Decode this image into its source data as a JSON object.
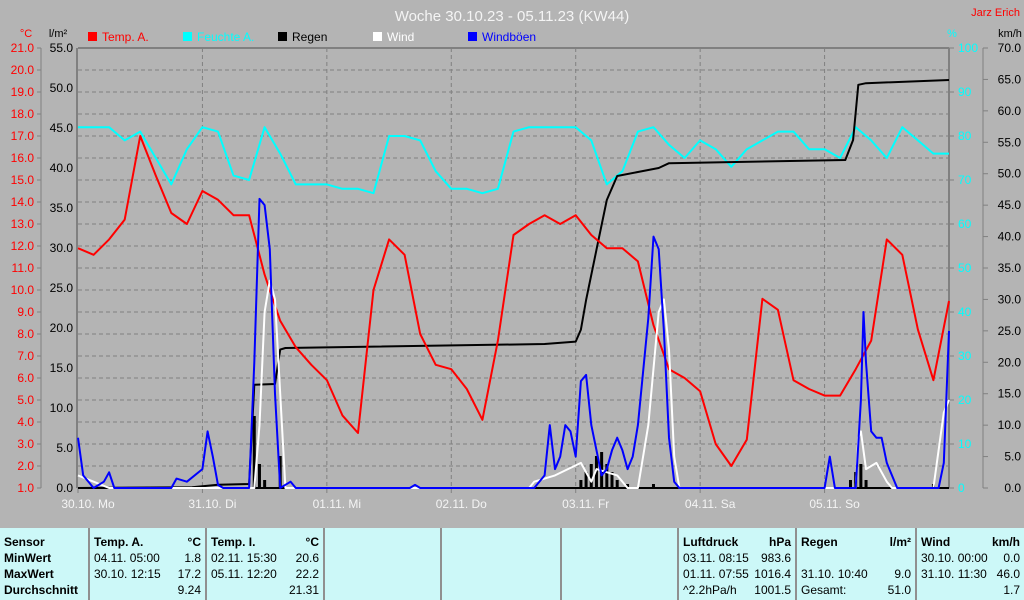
{
  "title": "Woche 30.10.23 - 05.11.23 (KW44)",
  "author": "Jarz Erich",
  "chart_data": {
    "type": "line",
    "title": "Woche 30.10.23 - 05.11.23 (KW44)",
    "x_unit": "hours since 30.10. 00:00",
    "xlim": [
      0,
      168
    ],
    "x_tick_labels": [
      "30.10. Mo",
      "31.10. Di",
      "01.11. Mi",
      "02.11. Do",
      "03.11. Fr",
      "04.11. Sa",
      "05.11. So"
    ],
    "axes": {
      "temp": {
        "label": "°C",
        "ylim": [
          1,
          21
        ],
        "ticks": [
          "1.0",
          "2.0",
          "3.0",
          "4.0",
          "5.0",
          "6.0",
          "7.0",
          "8.0",
          "9.0",
          "10.0",
          "11.0",
          "12.0",
          "13.0",
          "14.0",
          "15.0",
          "16.0",
          "17.0",
          "18.0",
          "19.0",
          "20.0",
          "21.0"
        ]
      },
      "rain": {
        "label": "l/m²",
        "ylim": [
          0,
          55
        ],
        "ticks": [
          "0.0",
          "5.0",
          "10.0",
          "15.0",
          "20.0",
          "25.0",
          "30.0",
          "35.0",
          "40.0",
          "45.0",
          "50.0",
          "55.0"
        ]
      },
      "humidity": {
        "label": "%",
        "ylim": [
          0,
          100
        ],
        "ticks": [
          "0",
          "10",
          "20",
          "30",
          "40",
          "50",
          "60",
          "70",
          "80",
          "90",
          "100"
        ]
      },
      "wind": {
        "label": "km/h",
        "ylim": [
          0,
          70
        ],
        "ticks": [
          "0.0",
          "5.0",
          "10.0",
          "15.0",
          "20.0",
          "25.0",
          "30.0",
          "35.0",
          "40.0",
          "45.0",
          "50.0",
          "55.0",
          "60.0",
          "65.0",
          "70.0"
        ]
      }
    },
    "legend_position": "top-left",
    "grid": true,
    "series": [
      {
        "name": "Temp. A.",
        "axis": "temp",
        "color": "#ff0000",
        "step_hours": 3,
        "values": [
          11.9,
          11.6,
          12.3,
          13.2,
          17.0,
          15.2,
          13.5,
          13.0,
          14.5,
          14.1,
          13.4,
          13.4,
          10.7,
          8.6,
          7.4,
          6.6,
          5.9,
          4.3,
          3.5,
          10.0,
          12.3,
          11.6,
          8.0,
          6.6,
          6.4,
          5.5,
          4.1,
          7.7,
          12.5,
          13.0,
          13.4,
          13.0,
          13.4,
          12.5,
          11.9,
          11.9,
          11.3,
          8.4,
          6.4,
          6.0,
          5.4,
          3.0,
          2.0,
          3.2,
          9.6,
          9.1,
          5.9,
          5.5,
          5.2,
          5.2,
          6.4,
          7.7,
          12.3,
          11.6,
          8.2,
          5.9,
          9.5
        ]
      },
      {
        "name": "Feuchte A.",
        "axis": "humidity",
        "color": "#00ffff",
        "step_hours": 3,
        "values": [
          82,
          82,
          82,
          79,
          81,
          75,
          69,
          77,
          82,
          81,
          71,
          70,
          82,
          76,
          69,
          69,
          69,
          68,
          68,
          67,
          80,
          80,
          79,
          72,
          68,
          68,
          67,
          68,
          81,
          82,
          82,
          82,
          82,
          79,
          69,
          72,
          81,
          82,
          78,
          75,
          79,
          77,
          73,
          77,
          79,
          81,
          81,
          77,
          77,
          75,
          82,
          79,
          75,
          82,
          79,
          76,
          76
        ]
      },
      {
        "name": "Regen",
        "axis": "rain",
        "color": "#000000",
        "points": [
          [
            0,
            0
          ],
          [
            22,
            0.1
          ],
          [
            27,
            0.4
          ],
          [
            33,
            0.5
          ],
          [
            34,
            12.9
          ],
          [
            38,
            13
          ],
          [
            39,
            17.3
          ],
          [
            40,
            17.5
          ],
          [
            90,
            18
          ],
          [
            96,
            18.3
          ],
          [
            97,
            19.8
          ],
          [
            98,
            23.5
          ],
          [
            100,
            29.8
          ],
          [
            102,
            36
          ],
          [
            104,
            39
          ],
          [
            108,
            39.5
          ],
          [
            112,
            40
          ],
          [
            114,
            40.6
          ],
          [
            148,
            41
          ],
          [
            149.5,
            43.5
          ],
          [
            150.5,
            50.4
          ],
          [
            152,
            50.6
          ],
          [
            168,
            51
          ]
        ],
        "bars": [
          [
            34,
            9
          ],
          [
            35,
            3
          ],
          [
            36,
            1
          ],
          [
            39,
            4
          ],
          [
            97,
            1
          ],
          [
            98,
            2
          ],
          [
            99,
            3
          ],
          [
            100,
            4
          ],
          [
            101,
            4.5
          ],
          [
            102,
            3
          ],
          [
            103,
            2
          ],
          [
            104,
            1
          ],
          [
            106,
            0.5
          ],
          [
            111,
            0.5
          ],
          [
            149,
            1
          ],
          [
            150,
            2
          ],
          [
            151,
            3
          ],
          [
            152,
            1
          ],
          [
            165,
            0.5
          ]
        ]
      },
      {
        "name": "Wind",
        "axis": "wind",
        "color": "#ffffff",
        "points": [
          [
            0,
            2
          ],
          [
            3,
            1
          ],
          [
            6,
            0
          ],
          [
            34,
            0
          ],
          [
            35,
            10
          ],
          [
            36,
            28
          ],
          [
            37,
            33
          ],
          [
            38,
            30
          ],
          [
            39,
            15
          ],
          [
            40,
            0
          ],
          [
            87,
            0
          ],
          [
            88,
            1
          ],
          [
            92,
            2
          ],
          [
            97,
            4
          ],
          [
            99,
            1
          ],
          [
            100,
            3
          ],
          [
            104,
            2
          ],
          [
            106,
            0
          ],
          [
            108,
            0
          ],
          [
            110,
            10
          ],
          [
            112,
            28
          ],
          [
            113,
            30
          ],
          [
            114,
            22
          ],
          [
            115,
            5
          ],
          [
            116,
            0
          ],
          [
            150,
            0
          ],
          [
            150.5,
            8
          ],
          [
            151,
            9
          ],
          [
            152,
            3
          ],
          [
            154,
            4
          ],
          [
            156,
            1
          ],
          [
            157,
            0
          ],
          [
            165,
            0
          ],
          [
            166,
            6
          ],
          [
            167,
            12
          ],
          [
            168,
            14
          ]
        ]
      },
      {
        "name": "Windböen",
        "axis": "wind",
        "color": "#0000ff",
        "points": [
          [
            0,
            8
          ],
          [
            1,
            2
          ],
          [
            3,
            0
          ],
          [
            5,
            1
          ],
          [
            6,
            2.5
          ],
          [
            7,
            0
          ],
          [
            18,
            0
          ],
          [
            19,
            1.5
          ],
          [
            21,
            1
          ],
          [
            24,
            3
          ],
          [
            25,
            9
          ],
          [
            26,
            5
          ],
          [
            27,
            0.5
          ],
          [
            28,
            0
          ],
          [
            33,
            0
          ],
          [
            34,
            20
          ],
          [
            35,
            46
          ],
          [
            36,
            45
          ],
          [
            37,
            38
          ],
          [
            38,
            15
          ],
          [
            39,
            0
          ],
          [
            41,
            1
          ],
          [
            42,
            0
          ],
          [
            64,
            0
          ],
          [
            65,
            0.5
          ],
          [
            66,
            0
          ],
          [
            88,
            0
          ],
          [
            90,
            2
          ],
          [
            91,
            10
          ],
          [
            92,
            3
          ],
          [
            93,
            5
          ],
          [
            94,
            10
          ],
          [
            95,
            9
          ],
          [
            96,
            5
          ],
          [
            97,
            17
          ],
          [
            98,
            18
          ],
          [
            99,
            10
          ],
          [
            100,
            6
          ],
          [
            101,
            2
          ],
          [
            102,
            3
          ],
          [
            103,
            6
          ],
          [
            104,
            8
          ],
          [
            105,
            6
          ],
          [
            106,
            3
          ],
          [
            107,
            5
          ],
          [
            108,
            10
          ],
          [
            110,
            27
          ],
          [
            111,
            40
          ],
          [
            112,
            38
          ],
          [
            113,
            25
          ],
          [
            114,
            8
          ],
          [
            115,
            1
          ],
          [
            116,
            0
          ],
          [
            144,
            0
          ],
          [
            145,
            5
          ],
          [
            146,
            0
          ],
          [
            150,
            0
          ],
          [
            151,
            14
          ],
          [
            151.5,
            28
          ],
          [
            152,
            20
          ],
          [
            153,
            9
          ],
          [
            154,
            8
          ],
          [
            155,
            8
          ],
          [
            156,
            4
          ],
          [
            158,
            0
          ],
          [
            166,
            0
          ],
          [
            167,
            4
          ],
          [
            168,
            25
          ]
        ]
      }
    ]
  },
  "table": {
    "sensor": {
      "header": "Sensor",
      "rows": [
        "MinWert",
        "MaxWert",
        "Durchschnitt"
      ]
    },
    "temp_a": {
      "header": "Temp. A.",
      "unit": "°C",
      "rows": [
        [
          "04.11.  05:00",
          "1.8"
        ],
        [
          "30.10.  12:15",
          "17.2"
        ],
        [
          "",
          "9.24"
        ]
      ]
    },
    "temp_i": {
      "header": "Temp. I.",
      "unit": "°C",
      "rows": [
        [
          "02.11.  15:30",
          "20.6"
        ],
        [
          "05.11.  12:20",
          "22.2"
        ],
        [
          "",
          "21.31"
        ]
      ]
    },
    "luftdruck": {
      "header": "Luftdruck",
      "unit": "hPa",
      "rows": [
        [
          "03.11.  08:15",
          "983.6"
        ],
        [
          "01.11.  07:55",
          "1016.4"
        ],
        [
          "^2.2hPa/h",
          "1001.5"
        ]
      ]
    },
    "regen": {
      "header": "Regen",
      "unit": "l/m²",
      "rows": [
        [
          "",
          ""
        ],
        [
          "31.10.  10:40",
          "9.0"
        ],
        [
          "Gesamt:",
          "51.0"
        ]
      ]
    },
    "wind": {
      "header": "Wind",
      "unit": "km/h",
      "rows": [
        [
          "30.10.  00:00",
          "0.0"
        ],
        [
          "31.10.  11:30",
          "46.0"
        ],
        [
          "",
          "1.7"
        ]
      ]
    }
  }
}
